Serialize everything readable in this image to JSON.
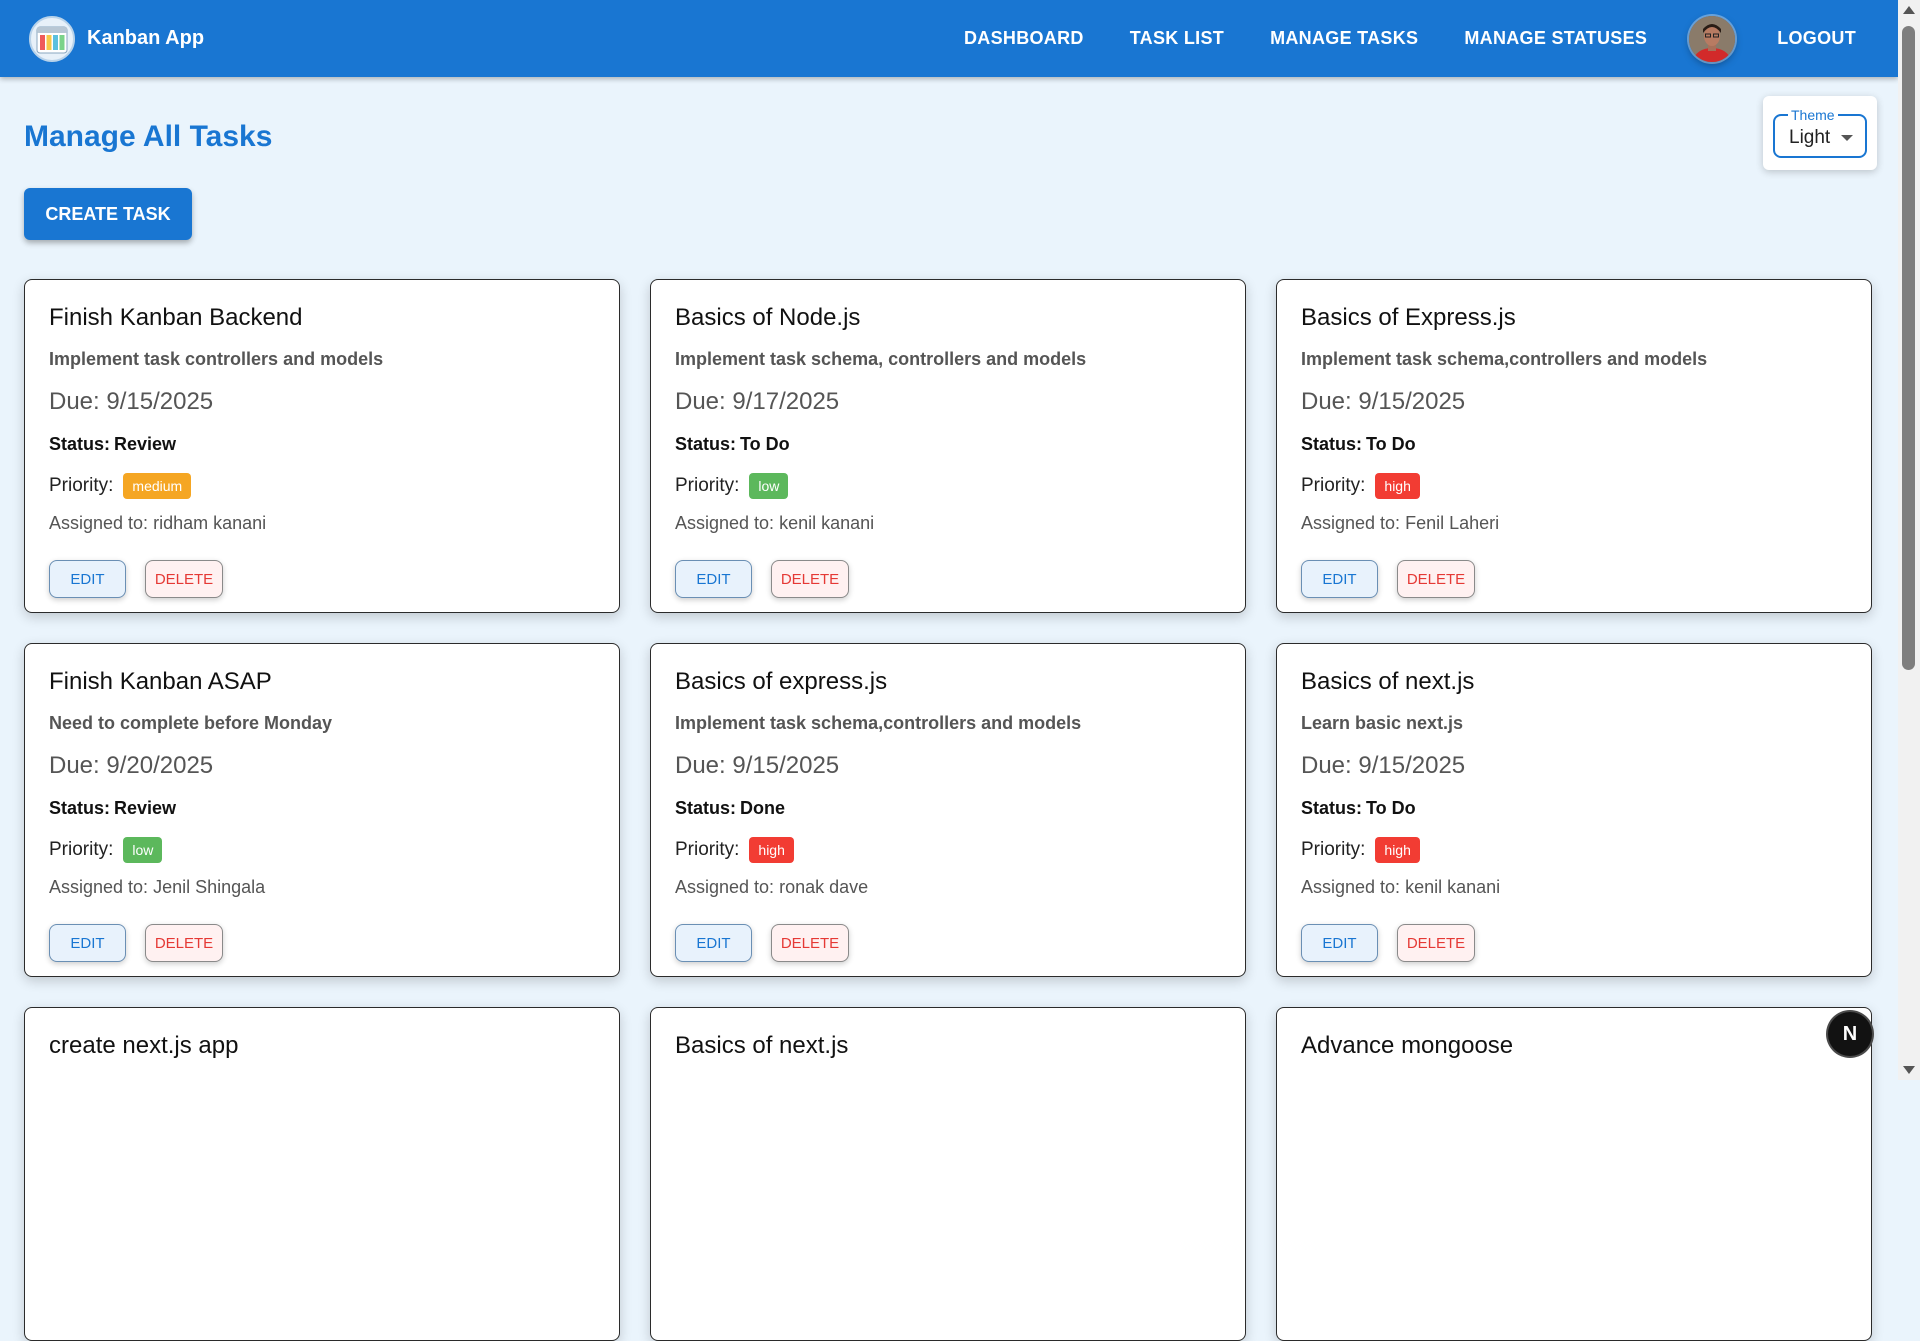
{
  "app": {
    "name": "Kanban App"
  },
  "nav": {
    "items": [
      "DASHBOARD",
      "TASK LIST",
      "MANAGE TASKS",
      "MANAGE STATUSES"
    ],
    "logout": "LOGOUT"
  },
  "theme": {
    "label": "Theme",
    "value": "Light"
  },
  "page": {
    "title": "Manage All Tasks",
    "create_label": "CREATE TASK"
  },
  "labels": {
    "due": "Due:",
    "status": "Status:",
    "priority": "Priority:",
    "assigned": "Assigned to:",
    "edit": "EDIT",
    "delete": "DELETE"
  },
  "priority_colors": {
    "medium": "#f5a623",
    "low": "#5cb85c",
    "high": "#f23c33"
  },
  "fab": {
    "label": "N"
  },
  "tasks": [
    {
      "title": "Finish Kanban Backend",
      "description": "Implement task controllers and models",
      "due": "9/15/2025",
      "status": "Review",
      "priority": "medium",
      "assigned": "ridham kanani"
    },
    {
      "title": "Basics of Node.js",
      "description": "Implement task schema, controllers and models",
      "due": "9/17/2025",
      "status": "To Do",
      "priority": "low",
      "assigned": "kenil kanani"
    },
    {
      "title": "Basics of Express.js",
      "description": "Implement task schema,controllers and models",
      "due": "9/15/2025",
      "status": "To Do",
      "priority": "high",
      "assigned": "Fenil Laheri"
    },
    {
      "title": "Finish Kanban ASAP",
      "description": "Need to complete before Monday",
      "due": "9/20/2025",
      "status": "Review",
      "priority": "low",
      "assigned": "Jenil Shingala"
    },
    {
      "title": "Basics of express.js",
      "description": "Implement task schema,controllers and models",
      "due": "9/15/2025",
      "status": "Done",
      "priority": "high",
      "assigned": "ronak dave"
    },
    {
      "title": "Basics of next.js",
      "description": "Learn basic next.js",
      "due": "9/15/2025",
      "status": "To Do",
      "priority": "high",
      "assigned": "kenil kanani"
    },
    {
      "title": "create next.js app"
    },
    {
      "title": "Basics of next.js"
    },
    {
      "title": "Advance mongoose"
    }
  ]
}
